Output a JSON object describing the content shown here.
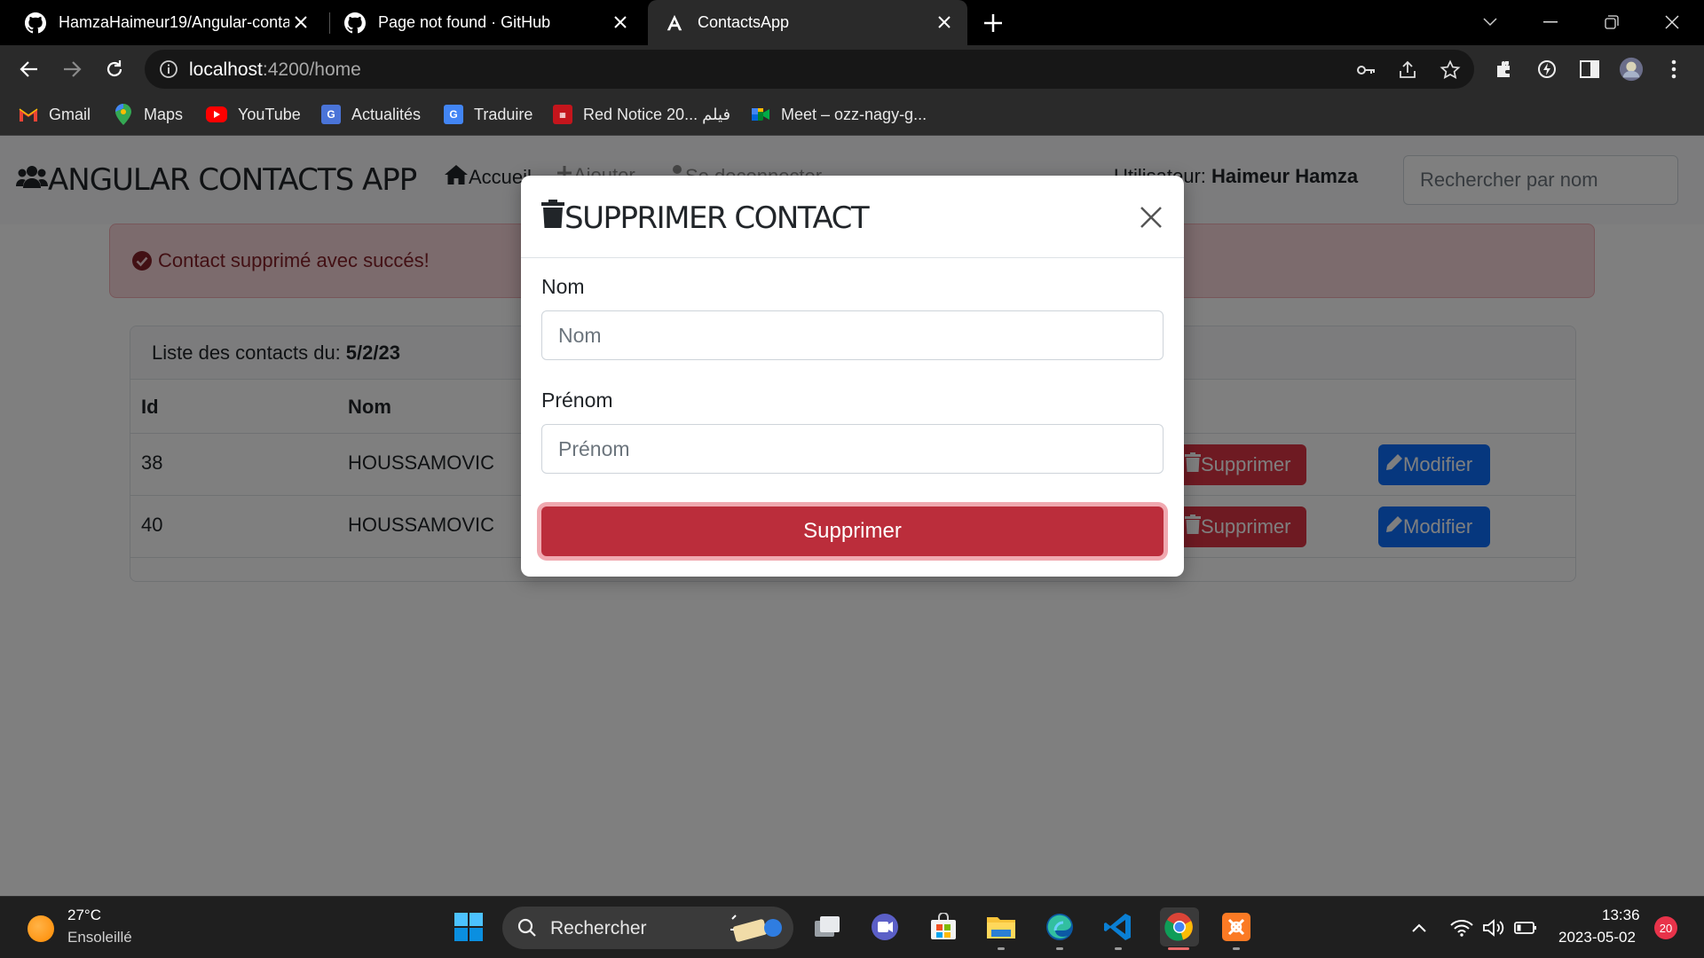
{
  "browser": {
    "tabs": [
      {
        "title": "HamzaHaimeur19/Angular-conta",
        "active": false
      },
      {
        "title": "Page not found · GitHub",
        "active": false
      },
      {
        "title": "ContactsApp",
        "active": true
      }
    ],
    "url_host": "localhost",
    "url_path": ":4200/home",
    "bookmarks": [
      {
        "label": "Gmail",
        "icon": "gmail-icon"
      },
      {
        "label": "Maps",
        "icon": "maps-icon"
      },
      {
        "label": "YouTube",
        "icon": "youtube-icon"
      },
      {
        "label": "Actualités",
        "icon": "news-icon"
      },
      {
        "label": "Traduire",
        "icon": "translate-icon"
      },
      {
        "label": "Red Notice 20... فيلم",
        "icon": "red-notice-icon"
      },
      {
        "label": "Meet – ozz-nagy-g...",
        "icon": "meet-icon"
      }
    ]
  },
  "app": {
    "brand": "ANGULAR CONTACTS APP",
    "nav": {
      "home": "Accueil",
      "add": "Ajouter",
      "logout": "Se deconnecter"
    },
    "user_prefix": "Utilisateur:",
    "user_name": "Haimeur Hamza",
    "search_placeholder": "Rechercher par nom",
    "alert": "Contact supprimé avec succés!",
    "list_title": "Liste des contacts du:",
    "list_date": "5/2/23",
    "table": {
      "headers": {
        "id": "Id",
        "nom": "Nom"
      },
      "rows": [
        {
          "id": "38",
          "nom": "HOUSSAMOVIC"
        },
        {
          "id": "40",
          "nom": "HOUSSAMOVIC"
        }
      ],
      "delete_label": "Supprimer",
      "edit_label": "Modifier"
    }
  },
  "modal": {
    "title": "SUPPRIMER CONTACT",
    "nom_label": "Nom",
    "nom_placeholder": "Nom",
    "prenom_label": "Prénom",
    "prenom_placeholder": "Prénom",
    "submit": "Supprimer"
  },
  "taskbar": {
    "temperature": "27°C",
    "weather": "Ensoleillé",
    "search": "Rechercher",
    "time": "13:36",
    "date": "2023-05-02",
    "notifications": "20"
  },
  "colors": {
    "danger": "#dc3545",
    "primary": "#0d6efd",
    "alert_bg": "#f8d7da"
  }
}
